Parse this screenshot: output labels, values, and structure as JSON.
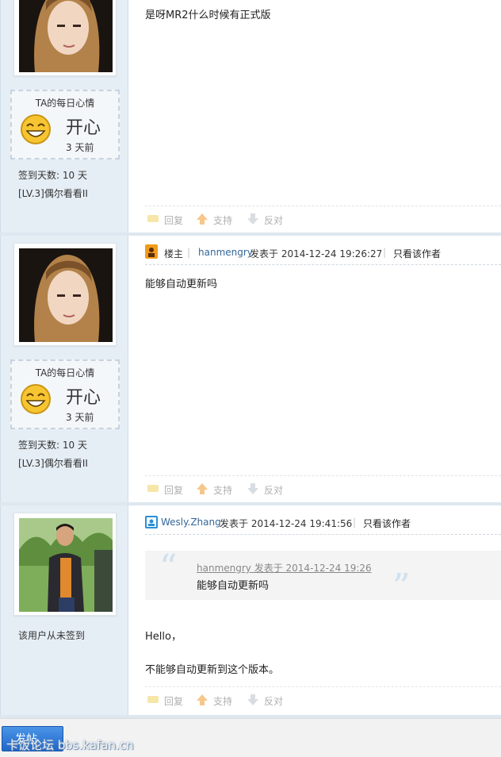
{
  "posts": [
    {
      "mood": {
        "title": "TA的每日心情",
        "word": "开心",
        "time": "3 天前"
      },
      "stats": {
        "sign_days": "签到天数: 10 天",
        "level": "[LV.3]偶尔看看II"
      },
      "body": [
        "是呀MR2什么时候有正式版"
      ],
      "actions": {
        "reply": "回复",
        "support": "支持",
        "oppose": "反对"
      }
    },
    {
      "role": "楼主",
      "author": "hanmengry",
      "posted": "发表于 2014-12-24 19:26:27",
      "only_author": "只看该作者",
      "mood": {
        "title": "TA的每日心情",
        "word": "开心",
        "time": "3 天前"
      },
      "stats": {
        "sign_days": "签到天数: 10 天",
        "level": "[LV.3]偶尔看看II"
      },
      "body": [
        "能够自动更新吗"
      ],
      "actions": {
        "reply": "回复",
        "support": "支持",
        "oppose": "反对"
      }
    },
    {
      "author": "Wesly.Zhang",
      "posted": "发表于 2014-12-24 19:41:56",
      "only_author": "只看该作者",
      "side_note": "该用户从未签到",
      "quote": {
        "header": "hanmengry 发表于 2014-12-24 19:26",
        "text": "能够自动更新吗"
      },
      "body": [
        "Hello，",
        "不能够自动更新到这个版本。"
      ],
      "actions": {
        "reply": "回复",
        "support": "支持",
        "oppose": "反对"
      }
    }
  ],
  "footer": {
    "post_button": "发帖",
    "watermark": "卡饭论坛 bbs.kafan.cn"
  },
  "colors": {
    "sidebar": "#e6eef5",
    "link": "#336699",
    "button": "#2f7ad8"
  }
}
